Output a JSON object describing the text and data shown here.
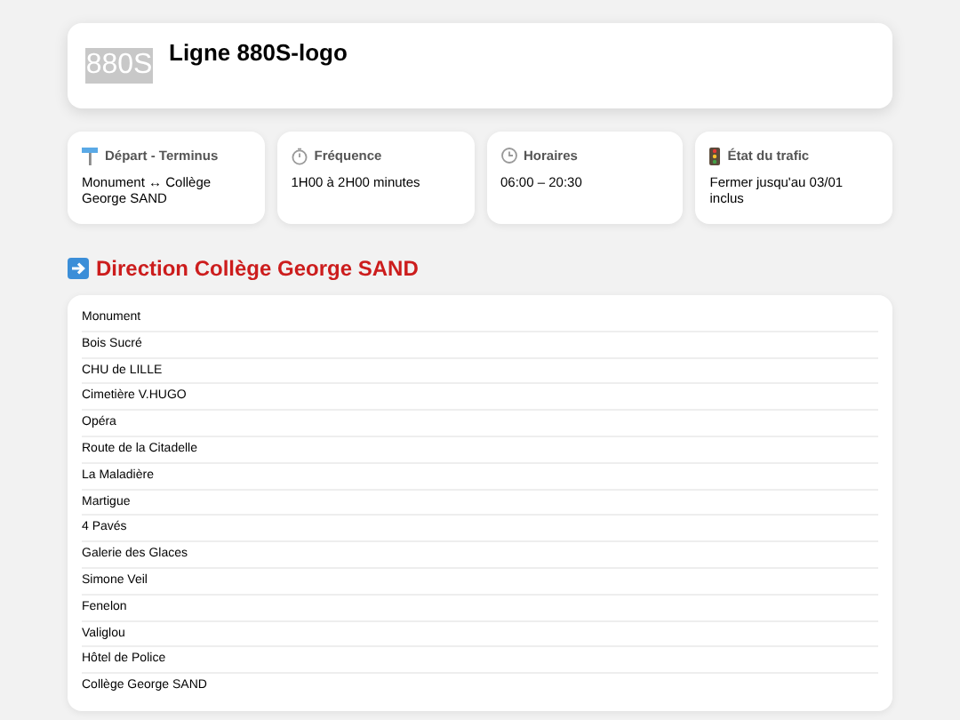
{
  "header": {
    "logo": "880S",
    "title": "Ligne 880S-logo"
  },
  "info_cards": [
    {
      "kind": "stop",
      "label": "Départ - Terminus",
      "value": "Monument ↔ Collège George SAND"
    },
    {
      "kind": "timer",
      "label": "Fréquence",
      "value": "1H00 à 2H00 minutes"
    },
    {
      "kind": "clock",
      "label": "Horaires",
      "value": "06:00 – 20:30"
    },
    {
      "kind": "traffic",
      "label": "État du trafic",
      "value": "Fermer jusqu'au 03/01 inclus"
    }
  ],
  "direction": {
    "title": "Direction Collège George SAND",
    "stops": [
      "Monument",
      "Bois Sucré",
      "CHU de LILLE",
      "Cimetière V.HUGO",
      "Opéra",
      "Route de la Citadelle",
      "La Maladière",
      "Martigue",
      "4 Pavés",
      "Galerie des Glaces",
      "Simone Veil",
      "Fenelon",
      "Valiglou",
      "Hôtel de Police",
      "Collège George SAND"
    ]
  }
}
